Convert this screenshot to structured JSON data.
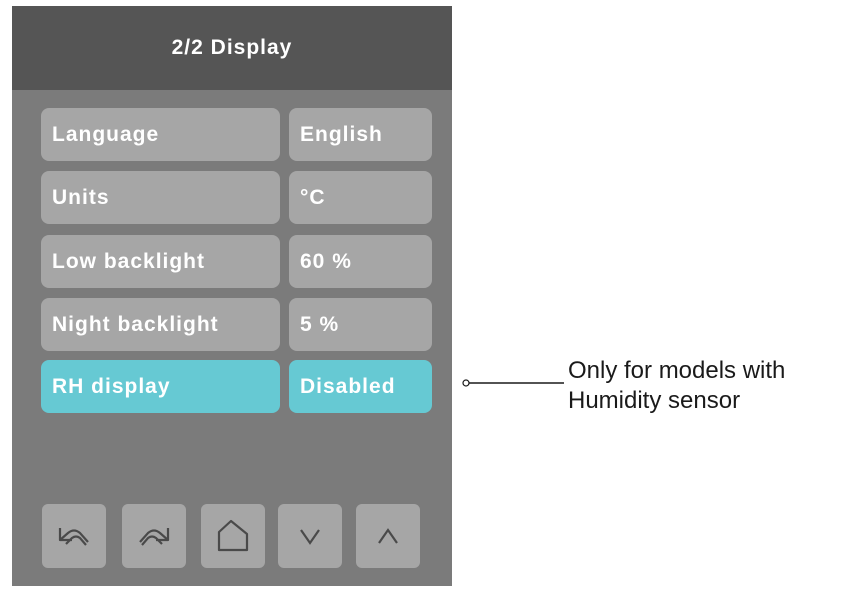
{
  "header": {
    "title": "2/2 Display"
  },
  "settings": [
    {
      "label": "Language",
      "value": "English",
      "active": false
    },
    {
      "label": "Units",
      "value": "°C",
      "active": false
    },
    {
      "label": "Low backlight",
      "value": "60 %",
      "active": false
    },
    {
      "label": "Night backlight",
      "value": " 5 %",
      "active": false
    },
    {
      "label": "RH display",
      "value": "Disabled",
      "active": true
    }
  ],
  "colors": {
    "panel": "#7b7b7b",
    "header": "#555555",
    "item": "#a6a6a6",
    "highlight": "#66c9d3"
  },
  "nav": [
    {
      "icon": "undo-icon"
    },
    {
      "icon": "redo-icon"
    },
    {
      "icon": "home-icon"
    },
    {
      "icon": "chevron-down-icon"
    },
    {
      "icon": "chevron-up-icon"
    }
  ],
  "callout": {
    "line1": "Only for models with",
    "line2": "Humidity sensor"
  }
}
